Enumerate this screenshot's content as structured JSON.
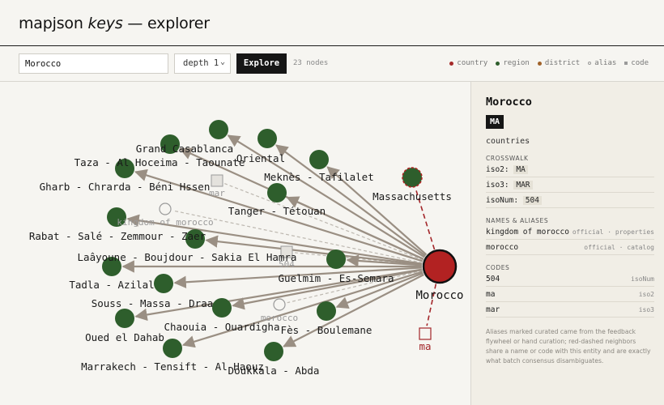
{
  "app": {
    "title_prefix": "mapjson ",
    "title_em": "keys",
    "title_suffix": " — explorer"
  },
  "toolbar": {
    "search_value": "Morocco",
    "depth_value": "depth 1",
    "explore_label": "Explore",
    "node_count": "23 nodes"
  },
  "legend": [
    {
      "label": "country",
      "color": "#a52a2a",
      "icon": "dot"
    },
    {
      "label": "region",
      "color": "#2e5e2c",
      "icon": "dot"
    },
    {
      "label": "district",
      "color": "#a0622a",
      "icon": "dot"
    },
    {
      "label": "alias",
      "color": "#9a9a9a",
      "icon": "ring"
    },
    {
      "label": "code",
      "color": "#9a9a9a",
      "icon": "square"
    }
  ],
  "graph": {
    "center": {
      "label": "Morocco",
      "color": "#b22222"
    },
    "nodes": [
      {
        "label": "Grand Casablanca",
        "kind": "region"
      },
      {
        "label": "Oriental",
        "kind": "region"
      },
      {
        "label": "Taza - Al Hoceima - Taounate",
        "kind": "region"
      },
      {
        "label": "Meknès - Tafilalet",
        "kind": "region"
      },
      {
        "label": "Massachusetts",
        "kind": "region-dashed"
      },
      {
        "label": "Gharb - Chrarda - Béni Hssen",
        "kind": "region"
      },
      {
        "label": "mar",
        "kind": "code"
      },
      {
        "label": "Tanger - Tétouan",
        "kind": "region"
      },
      {
        "label": "kingdom of morocco",
        "kind": "alias"
      },
      {
        "label": "Rabat - Salé - Zemmour - Zaer",
        "kind": "region"
      },
      {
        "label": "504",
        "kind": "code"
      },
      {
        "label": "Laâyoune - Boujdour - Sakia El Hamra",
        "kind": "region"
      },
      {
        "label": "Guelmim - Es-Semara",
        "kind": "region"
      },
      {
        "label": "Tadla - Azilal",
        "kind": "region"
      },
      {
        "label": "Souss - Massa - Draa",
        "kind": "region"
      },
      {
        "label": "morocco",
        "kind": "alias"
      },
      {
        "label": "Oued el Dahab",
        "kind": "region"
      },
      {
        "label": "Chaouia - Ouardigha",
        "kind": "region"
      },
      {
        "label": "Fès - Boulemane",
        "kind": "region"
      },
      {
        "label": "Marrakech - Tensift - Al Haouz",
        "kind": "region"
      },
      {
        "label": "Doukkala - Abda",
        "kind": "region"
      },
      {
        "label": "ma",
        "kind": "code-dashed"
      }
    ]
  },
  "panel": {
    "name": "Morocco",
    "badge": "MA",
    "type": "countries",
    "crosswalk_title": "CROSSWALK",
    "crosswalk": [
      {
        "key": "iso2:",
        "value": "MA"
      },
      {
        "key": "iso3:",
        "value": "MAR"
      },
      {
        "key": "isoNum:",
        "value": "504"
      }
    ],
    "names_title": "NAMES & ALIASES",
    "names": [
      {
        "name": "kingdom of morocco",
        "meta": "official · properties"
      },
      {
        "name": "morocco",
        "meta": "official · catalog"
      }
    ],
    "codes_title": "CODES",
    "codes": [
      {
        "code": "504",
        "meta": "isoNum"
      },
      {
        "code": "ma",
        "meta": "iso2"
      },
      {
        "code": "mar",
        "meta": "iso3"
      }
    ],
    "note": "Aliases marked curated came from the feedback flywheel or hand curation; red-dashed neighbors share a name or code with this entity and are exactly what batch consensus disambiguates."
  }
}
